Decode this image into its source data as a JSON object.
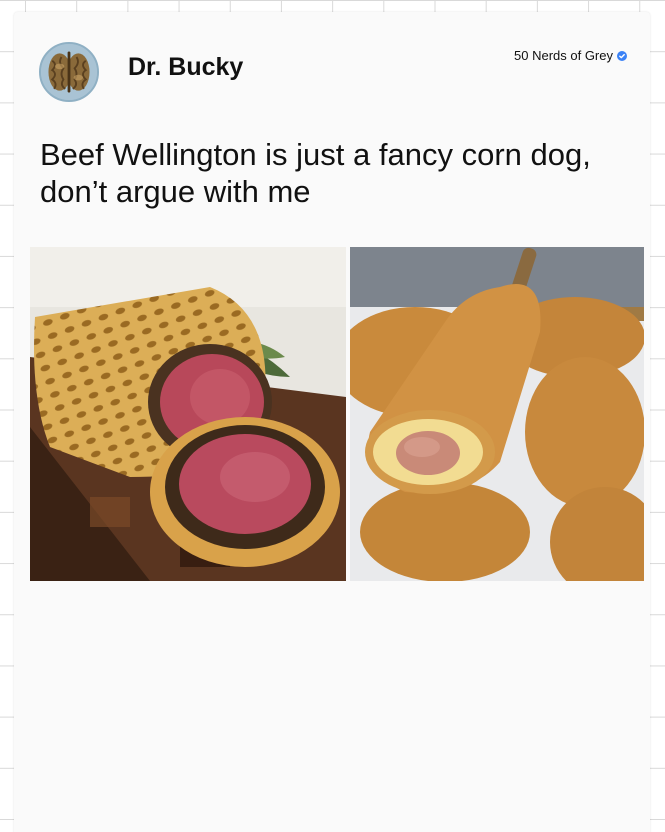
{
  "post": {
    "author": "Dr. Bucky",
    "source": "50 Nerds of Grey",
    "text": "Beef Wellington is just a fancy corn dog, don’t argue with me"
  },
  "icons": {
    "avatar": "walnut-avatar-icon",
    "verified": "verified-badge-icon"
  },
  "images": [
    {
      "name": "beef-wellington-photo"
    },
    {
      "name": "corn-dogs-photo"
    }
  ],
  "colors": {
    "card": "#fafafa",
    "grid": "#d9d9d9",
    "verified": "#3b82f6"
  }
}
